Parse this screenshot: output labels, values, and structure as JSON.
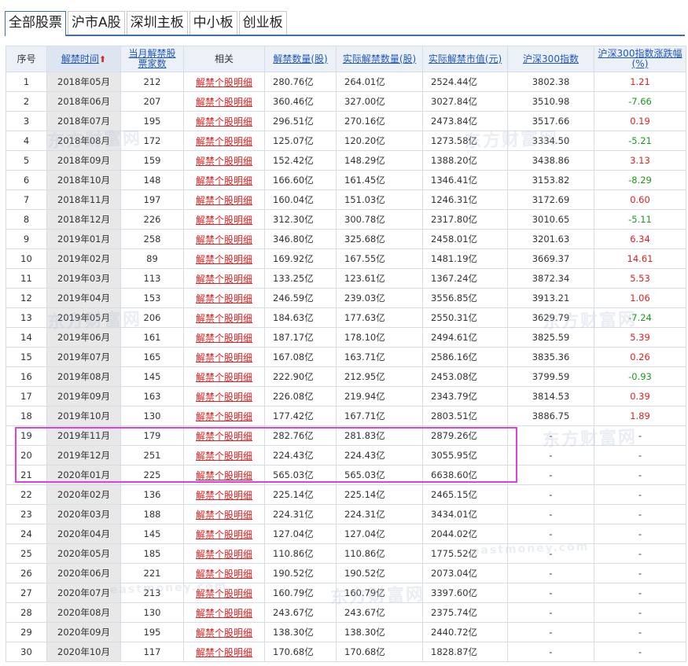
{
  "tabs": [
    "全部股票",
    "沪市A股",
    "深圳主板",
    "中小板",
    "创业板"
  ],
  "columns": {
    "seq": "序号",
    "date": "解禁时间",
    "count": "当月解禁股票家数",
    "related": "相关",
    "qty": "解禁数量(股)",
    "actual_qty": "实际解禁数量(股)",
    "actual_value": "实际解禁市值(元)",
    "hs300": "沪深300指数",
    "change": "沪深300指数涨跌幅(%)"
  },
  "sort_arrow": "⬆",
  "link_label": "解禁个股明细",
  "rows": [
    {
      "seq": "1",
      "date": "2018年05月",
      "count": "212",
      "qty": "280.76亿",
      "actual_qty": "264.01亿",
      "value": "2524.44亿",
      "hs300": "3802.38",
      "change": "1.21",
      "dir": "up"
    },
    {
      "seq": "2",
      "date": "2018年06月",
      "count": "207",
      "qty": "360.46亿",
      "actual_qty": "327.00亿",
      "value": "3027.84亿",
      "hs300": "3510.98",
      "change": "-7.66",
      "dir": "down"
    },
    {
      "seq": "3",
      "date": "2018年07月",
      "count": "195",
      "qty": "296.51亿",
      "actual_qty": "270.16亿",
      "value": "2473.84亿",
      "hs300": "3517.66",
      "change": "0.19",
      "dir": "up"
    },
    {
      "seq": "4",
      "date": "2018年08月",
      "count": "172",
      "qty": "125.07亿",
      "actual_qty": "120.20亿",
      "value": "1273.58亿",
      "hs300": "3334.50",
      "change": "-5.21",
      "dir": "down"
    },
    {
      "seq": "5",
      "date": "2018年09月",
      "count": "159",
      "qty": "152.42亿",
      "actual_qty": "148.29亿",
      "value": "1388.20亿",
      "hs300": "3438.86",
      "change": "3.13",
      "dir": "up"
    },
    {
      "seq": "6",
      "date": "2018年10月",
      "count": "148",
      "qty": "166.60亿",
      "actual_qty": "161.45亿",
      "value": "1346.41亿",
      "hs300": "3153.82",
      "change": "-8.29",
      "dir": "down"
    },
    {
      "seq": "7",
      "date": "2018年11月",
      "count": "197",
      "qty": "160.04亿",
      "actual_qty": "151.03亿",
      "value": "1246.31亿",
      "hs300": "3172.69",
      "change": "0.60",
      "dir": "up"
    },
    {
      "seq": "8",
      "date": "2018年12月",
      "count": "226",
      "qty": "312.30亿",
      "actual_qty": "300.78亿",
      "value": "2317.80亿",
      "hs300": "3010.65",
      "change": "-5.11",
      "dir": "down"
    },
    {
      "seq": "9",
      "date": "2019年01月",
      "count": "258",
      "qty": "346.80亿",
      "actual_qty": "325.68亿",
      "value": "2458.01亿",
      "hs300": "3201.63",
      "change": "6.34",
      "dir": "up"
    },
    {
      "seq": "10",
      "date": "2019年02月",
      "count": "89",
      "qty": "169.92亿",
      "actual_qty": "167.55亿",
      "value": "1481.19亿",
      "hs300": "3669.37",
      "change": "14.61",
      "dir": "up"
    },
    {
      "seq": "11",
      "date": "2019年03月",
      "count": "113",
      "qty": "133.25亿",
      "actual_qty": "123.61亿",
      "value": "1367.24亿",
      "hs300": "3872.34",
      "change": "5.53",
      "dir": "up"
    },
    {
      "seq": "12",
      "date": "2019年04月",
      "count": "153",
      "qty": "246.59亿",
      "actual_qty": "239.03亿",
      "value": "3556.85亿",
      "hs300": "3913.21",
      "change": "1.06",
      "dir": "up"
    },
    {
      "seq": "13",
      "date": "2019年05月",
      "count": "206",
      "qty": "184.63亿",
      "actual_qty": "177.63亿",
      "value": "2550.31亿",
      "hs300": "3629.79",
      "change": "-7.24",
      "dir": "down"
    },
    {
      "seq": "14",
      "date": "2019年06月",
      "count": "161",
      "qty": "187.17亿",
      "actual_qty": "178.10亿",
      "value": "2494.61亿",
      "hs300": "3825.59",
      "change": "5.39",
      "dir": "up"
    },
    {
      "seq": "15",
      "date": "2019年07月",
      "count": "165",
      "qty": "167.08亿",
      "actual_qty": "163.71亿",
      "value": "2586.16亿",
      "hs300": "3835.36",
      "change": "0.26",
      "dir": "up"
    },
    {
      "seq": "16",
      "date": "2019年08月",
      "count": "145",
      "qty": "222.90亿",
      "actual_qty": "212.95亿",
      "value": "2453.08亿",
      "hs300": "3799.59",
      "change": "-0.93",
      "dir": "down"
    },
    {
      "seq": "17",
      "date": "2019年09月",
      "count": "163",
      "qty": "226.08亿",
      "actual_qty": "219.94亿",
      "value": "2343.79亿",
      "hs300": "3814.53",
      "change": "0.39",
      "dir": "up"
    },
    {
      "seq": "18",
      "date": "2019年10月",
      "count": "130",
      "qty": "177.42亿",
      "actual_qty": "167.71亿",
      "value": "2803.51亿",
      "hs300": "3886.75",
      "change": "1.89",
      "dir": "up"
    },
    {
      "seq": "19",
      "date": "2019年11月",
      "count": "179",
      "qty": "282.76亿",
      "actual_qty": "281.83亿",
      "value": "2879.26亿",
      "hs300": "-",
      "change": "-",
      "dir": ""
    },
    {
      "seq": "20",
      "date": "2019年12月",
      "count": "251",
      "qty": "224.43亿",
      "actual_qty": "224.43亿",
      "value": "3055.95亿",
      "hs300": "-",
      "change": "-",
      "dir": ""
    },
    {
      "seq": "21",
      "date": "2020年01月",
      "count": "225",
      "qty": "565.03亿",
      "actual_qty": "565.03亿",
      "value": "6638.60亿",
      "hs300": "-",
      "change": "-",
      "dir": ""
    },
    {
      "seq": "22",
      "date": "2020年02月",
      "count": "136",
      "qty": "225.14亿",
      "actual_qty": "225.14亿",
      "value": "2465.15亿",
      "hs300": "-",
      "change": "-",
      "dir": ""
    },
    {
      "seq": "23",
      "date": "2020年03月",
      "count": "188",
      "qty": "224.31亿",
      "actual_qty": "224.31亿",
      "value": "3434.01亿",
      "hs300": "-",
      "change": "-",
      "dir": ""
    },
    {
      "seq": "24",
      "date": "2020年04月",
      "count": "145",
      "qty": "127.04亿",
      "actual_qty": "127.04亿",
      "value": "2044.02亿",
      "hs300": "-",
      "change": "-",
      "dir": ""
    },
    {
      "seq": "25",
      "date": "2020年05月",
      "count": "185",
      "qty": "110.86亿",
      "actual_qty": "110.86亿",
      "value": "1775.52亿",
      "hs300": "-",
      "change": "-",
      "dir": ""
    },
    {
      "seq": "26",
      "date": "2020年06月",
      "count": "221",
      "qty": "190.52亿",
      "actual_qty": "190.52亿",
      "value": "2073.04亿",
      "hs300": "-",
      "change": "-",
      "dir": ""
    },
    {
      "seq": "27",
      "date": "2020年07月",
      "count": "213",
      "qty": "160.79亿",
      "actual_qty": "160.79亿",
      "value": "3397.60亿",
      "hs300": "-",
      "change": "-",
      "dir": ""
    },
    {
      "seq": "28",
      "date": "2020年08月",
      "count": "130",
      "qty": "243.67亿",
      "actual_qty": "243.67亿",
      "value": "2375.74亿",
      "hs300": "-",
      "change": "-",
      "dir": ""
    },
    {
      "seq": "29",
      "date": "2020年09月",
      "count": "195",
      "qty": "138.30亿",
      "actual_qty": "138.30亿",
      "value": "2440.72亿",
      "hs300": "-",
      "change": "-",
      "dir": ""
    },
    {
      "seq": "30",
      "date": "2020年10月",
      "count": "117",
      "qty": "170.68亿",
      "actual_qty": "170.68亿",
      "value": "1828.87亿",
      "hs300": "-",
      "change": "-",
      "dir": ""
    }
  ],
  "watermark": {
    "cn": "东方财富网",
    "en": "eastmoney.com"
  },
  "colors": {
    "up": "#e02020",
    "down": "#1a9a1a",
    "link": "#e02020",
    "header_link": "#1f56c5",
    "highlight": "#e040e0"
  }
}
